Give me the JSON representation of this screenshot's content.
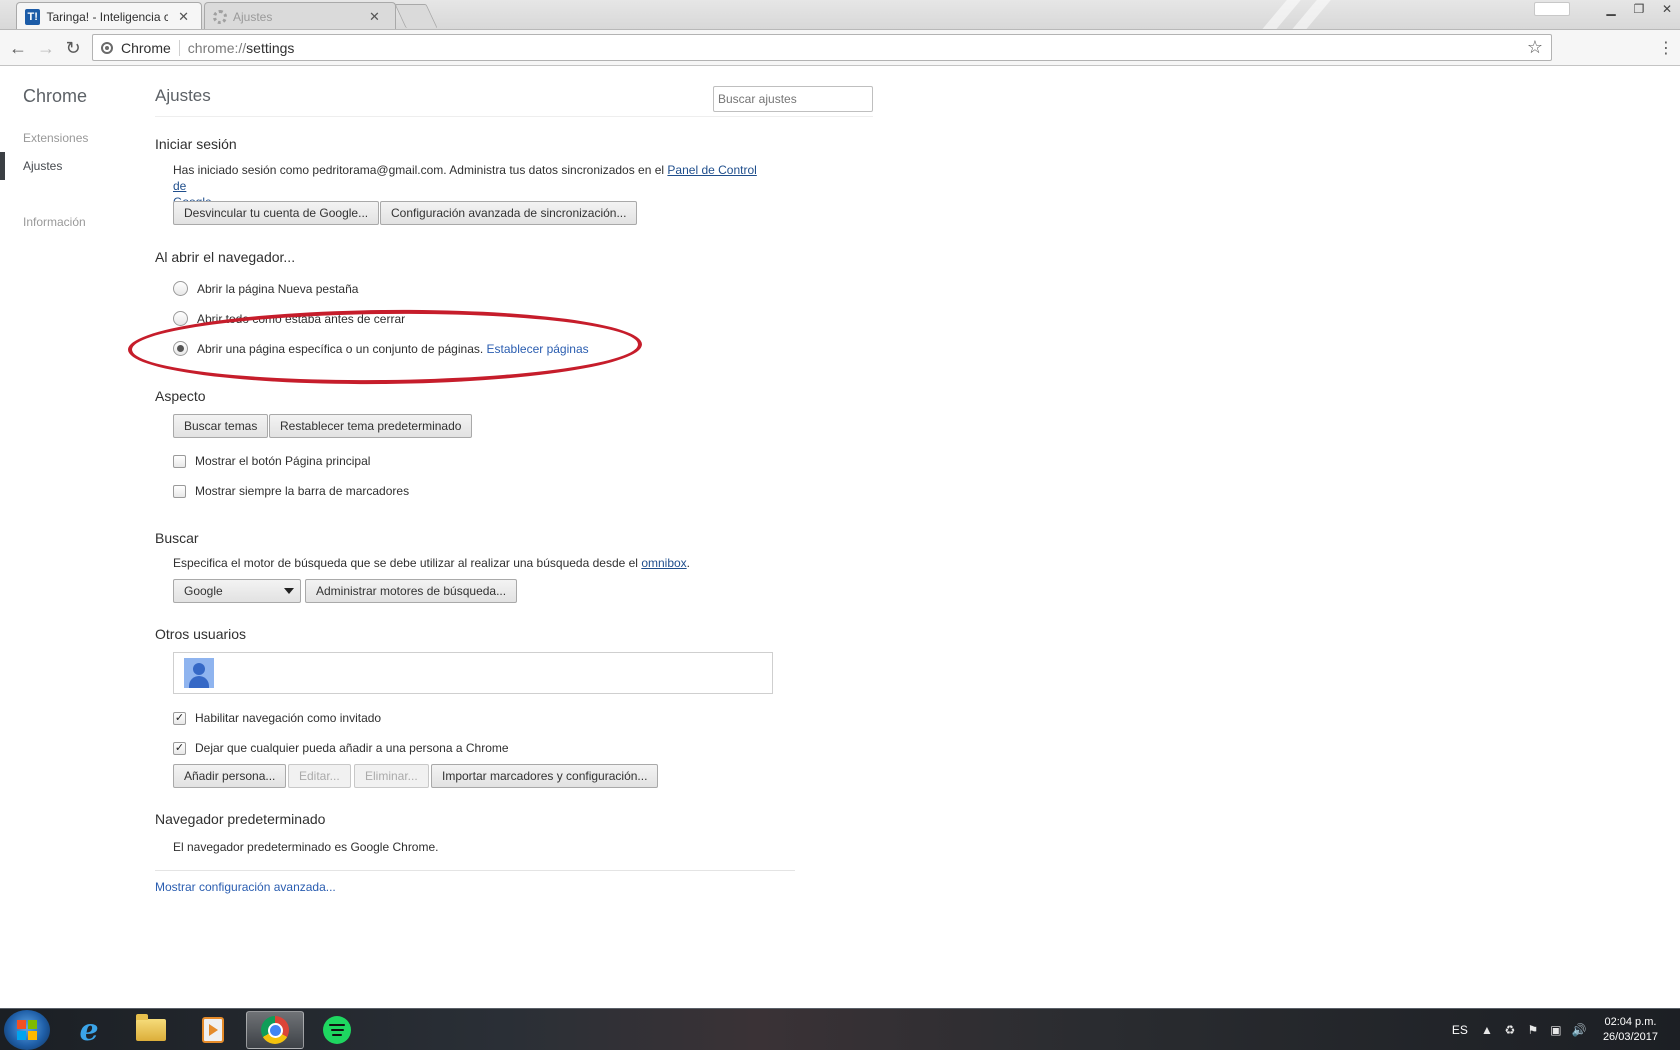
{
  "tabs": [
    {
      "label": "Taringa! - Inteligencia co",
      "state": "active",
      "favicon": "taringa-icon"
    },
    {
      "label": "Ajustes",
      "state": "inactive",
      "favicon": "gear-icon"
    }
  ],
  "omnibox": {
    "chip": "Chrome",
    "url_scheme": "chrome://",
    "url_path": "settings"
  },
  "sidebar": {
    "brand": "Chrome",
    "items": [
      {
        "label": "Extensiones",
        "selected": false
      },
      {
        "label": "Ajustes",
        "selected": true
      },
      {
        "label": "Información",
        "selected": false
      }
    ]
  },
  "header": {
    "title": "Ajustes",
    "search_placeholder": "Buscar ajustes"
  },
  "signin": {
    "title": "Iniciar sesión",
    "text_before": "Has iniciado sesión como pedritorama@gmail.com. Administra tus datos sincronizados en el ",
    "link_line1": "Panel de Control de",
    "link_line2": "Google",
    "text_after": ".",
    "btn_disconnect": "Desvincular tu cuenta de Google...",
    "btn_advanced_sync": "Configuración avanzada de sincronización..."
  },
  "startup": {
    "title": "Al abrir el navegador...",
    "options": [
      {
        "label": "Abrir la página Nueva pestaña",
        "checked": false
      },
      {
        "label": "Abrir todo como estaba antes de cerrar",
        "checked": false
      },
      {
        "label": "Abrir una página específica o un conjunto de páginas.",
        "checked": true,
        "link": "Establecer páginas"
      }
    ]
  },
  "appearance": {
    "title": "Aspecto",
    "btn_themes": "Buscar temas",
    "btn_reset_theme": "Restablecer tema predeterminado",
    "checkboxes": [
      {
        "label": "Mostrar el botón Página principal",
        "checked": false
      },
      {
        "label": "Mostrar siempre la barra de marcadores",
        "checked": false
      }
    ]
  },
  "search": {
    "title": "Buscar",
    "text_before": "Especifica el motor de búsqueda que se debe utilizar al realizar una búsqueda desde el ",
    "link": "omnibox",
    "text_after": ".",
    "engine": "Google",
    "btn_manage": "Administrar motores de búsqueda..."
  },
  "users": {
    "title": "Otros usuarios",
    "checkboxes": [
      {
        "label": "Habilitar navegación como invitado",
        "checked": true
      },
      {
        "label": "Dejar que cualquier pueda añadir a una persona a Chrome",
        "checked": true
      }
    ],
    "btn_add": "Añadir persona...",
    "btn_edit": "Editar...",
    "btn_remove": "Eliminar...",
    "btn_import": "Importar marcadores y configuración..."
  },
  "default_browser": {
    "title": "Navegador predeterminado",
    "text": "El navegador predeterminado es Google Chrome."
  },
  "advanced_link": "Mostrar configuración avanzada...",
  "annotation_color": "#c61d2b",
  "taskbar": {
    "apps": [
      "internet-explorer-icon",
      "file-explorer-icon",
      "media-player-icon",
      "chrome-icon",
      "spotify-icon"
    ],
    "active_app": "chrome-icon",
    "language": "ES",
    "time": "02:04 p.m.",
    "date": "26/03/2017"
  }
}
